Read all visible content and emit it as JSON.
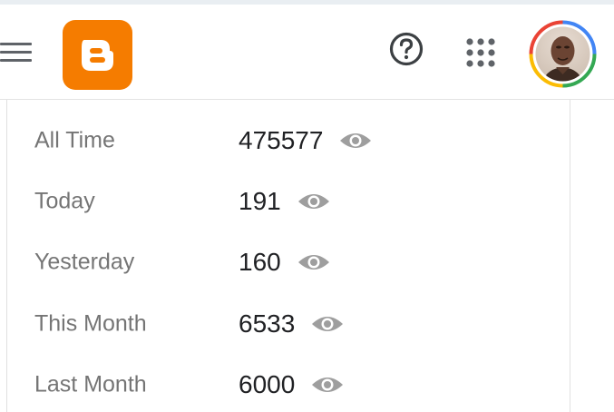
{
  "header": {
    "menu_icon": "hamburger-menu-icon",
    "logo_icon": "blogger-logo-icon",
    "help_icon": "help-circle-icon",
    "apps_icon": "apps-grid-icon",
    "avatar": "user-avatar"
  },
  "stats": {
    "view_icon": "eye-icon",
    "rows": [
      {
        "label": "All Time",
        "value": "475577"
      },
      {
        "label": "Today",
        "value": "191"
      },
      {
        "label": "Yesterday",
        "value": "160"
      },
      {
        "label": "This Month",
        "value": "6533"
      },
      {
        "label": "Last Month",
        "value": "6000"
      }
    ]
  },
  "colors": {
    "brand_orange": "#f57c00",
    "label_gray": "#757575",
    "value_dark": "#202124",
    "icon_gray": "#9e9e9e",
    "ring_blue": "#4285f4",
    "ring_red": "#ea4335",
    "ring_yellow": "#fbbc04",
    "ring_green": "#34a853"
  }
}
